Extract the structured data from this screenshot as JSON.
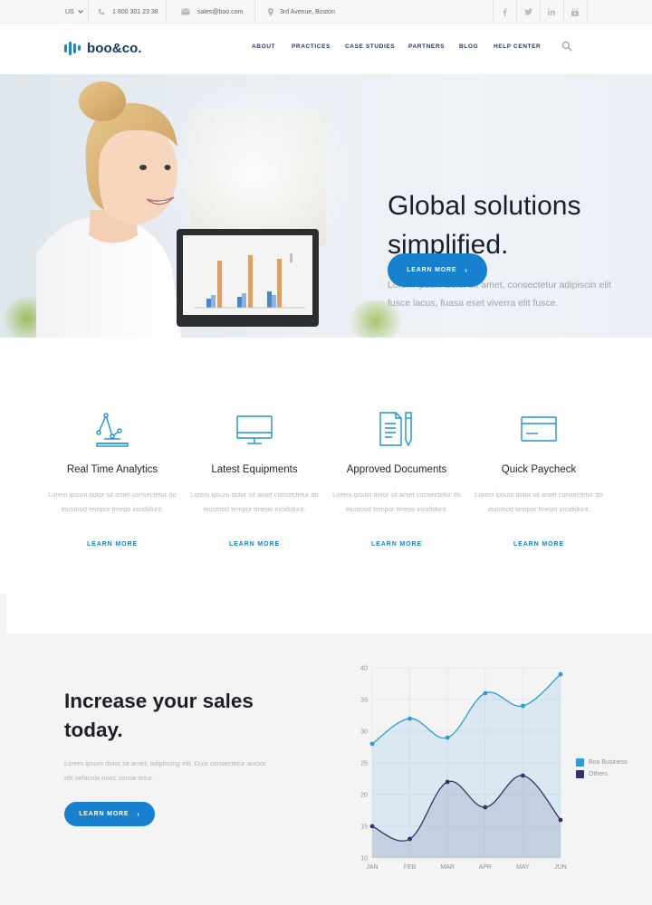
{
  "topbar": {
    "locale": "US",
    "phone": "1 800 301 23 38",
    "email": "sales@boo.com",
    "address": "3rd Avenue, Boston",
    "socials": [
      "facebook-icon",
      "twitter-icon",
      "linkedin-icon",
      "youtube-icon"
    ]
  },
  "header": {
    "logo": "boo&co.",
    "nav": [
      "ABOUT",
      "PRACTICES",
      "CASE STUDIES",
      "PARTNERS",
      "BLOG",
      "HELP CENTER"
    ]
  },
  "hero": {
    "title": "Global solutions simplified.",
    "text": "Lorem ipsum dolor sit amet, consectetur adipiscin elit fusce lacus, fuasa eset viverra elit fusce.",
    "button": "LEARN MORE"
  },
  "features": [
    {
      "icon": "analytics-icon",
      "title": "Real Time Analytics",
      "desc": "Lorem ipsum dolor sit amet consectetur do eiusmod tempor tmepo incididunt.",
      "link": "LEARN MORE"
    },
    {
      "icon": "monitor-icon",
      "title": "Latest Equipments",
      "desc": "Lorem ipsum dolor sit amet consectetur do eiusmod tempor tmepo incididunt.",
      "link": "LEARN MORE"
    },
    {
      "icon": "document-icon",
      "title": "Approved Documents",
      "desc": "Lorem ipsum dolor sit amet consectetur do eiusmod tempor tmepo incididunt.",
      "link": "LEARN MORE"
    },
    {
      "icon": "credit-card-icon",
      "title": "Quick Paycheck",
      "desc": "Lorem ipsum dolor sit amet consectetur do eiusmod tempor tmepo incididunt.",
      "link": "LEARN MORE"
    }
  ],
  "sales": {
    "title": "Increase your sales today.",
    "text": "Lorem ipsum dolor sit amet, adipiscing elit. Duis consectetur auctor elit vehicula onec conse tetur.",
    "button": "LEARN MORE"
  },
  "colors": {
    "accent": "#1780cf",
    "series_primary": "#2e9ad8",
    "series_secondary": "#2f3470"
  },
  "chart_data": {
    "type": "area",
    "categories": [
      "JAN",
      "FEB",
      "MAR",
      "APR",
      "MAY",
      "JUN"
    ],
    "series": [
      {
        "name": "Boo Business",
        "values": [
          28,
          32,
          29,
          36,
          34,
          39
        ]
      },
      {
        "name": "Others",
        "values": [
          15,
          13,
          22,
          18,
          23,
          16
        ]
      }
    ],
    "y_ticks": [
      10,
      15,
      20,
      25,
      30,
      35,
      40
    ],
    "ylim": [
      10,
      40
    ],
    "grid": true,
    "legend_position": "right",
    "title": "",
    "xlabel": "",
    "ylabel": ""
  }
}
